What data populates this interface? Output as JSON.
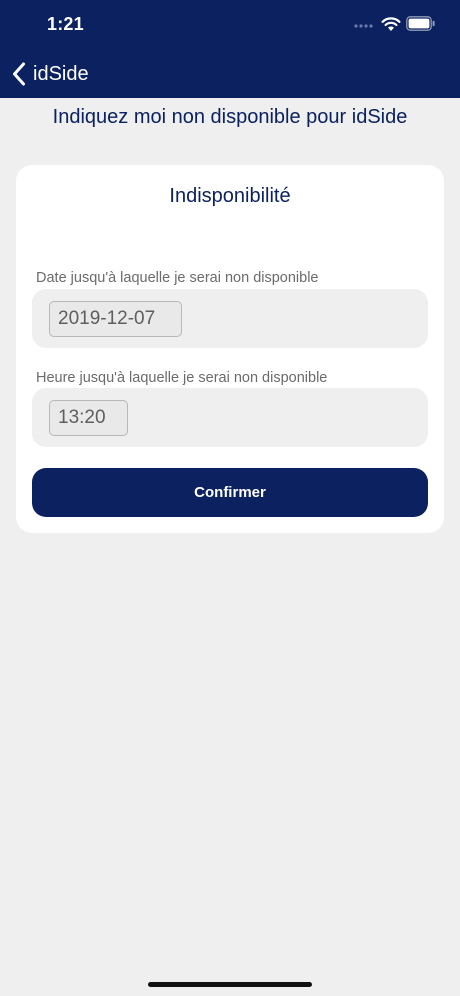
{
  "status_bar": {
    "time": "1:21",
    "icons": [
      "signal-icon",
      "wifi-icon",
      "battery-icon"
    ]
  },
  "nav": {
    "back_label": "idSide",
    "back_icon": "chevron-left-icon"
  },
  "page": {
    "title": "Indiquez moi non disponible pour idSide"
  },
  "card": {
    "title": "Indisponibilité",
    "date_label": "Date jusqu'à laquelle je serai non disponible",
    "date_value": "2019-12-07",
    "time_label": "Heure jusqu'à laquelle je serai non disponible",
    "time_value": "13:20",
    "confirm_label": "Confirmer"
  },
  "colors": {
    "navy": "#0c2260",
    "background": "#efefef",
    "card": "#ffffff"
  }
}
